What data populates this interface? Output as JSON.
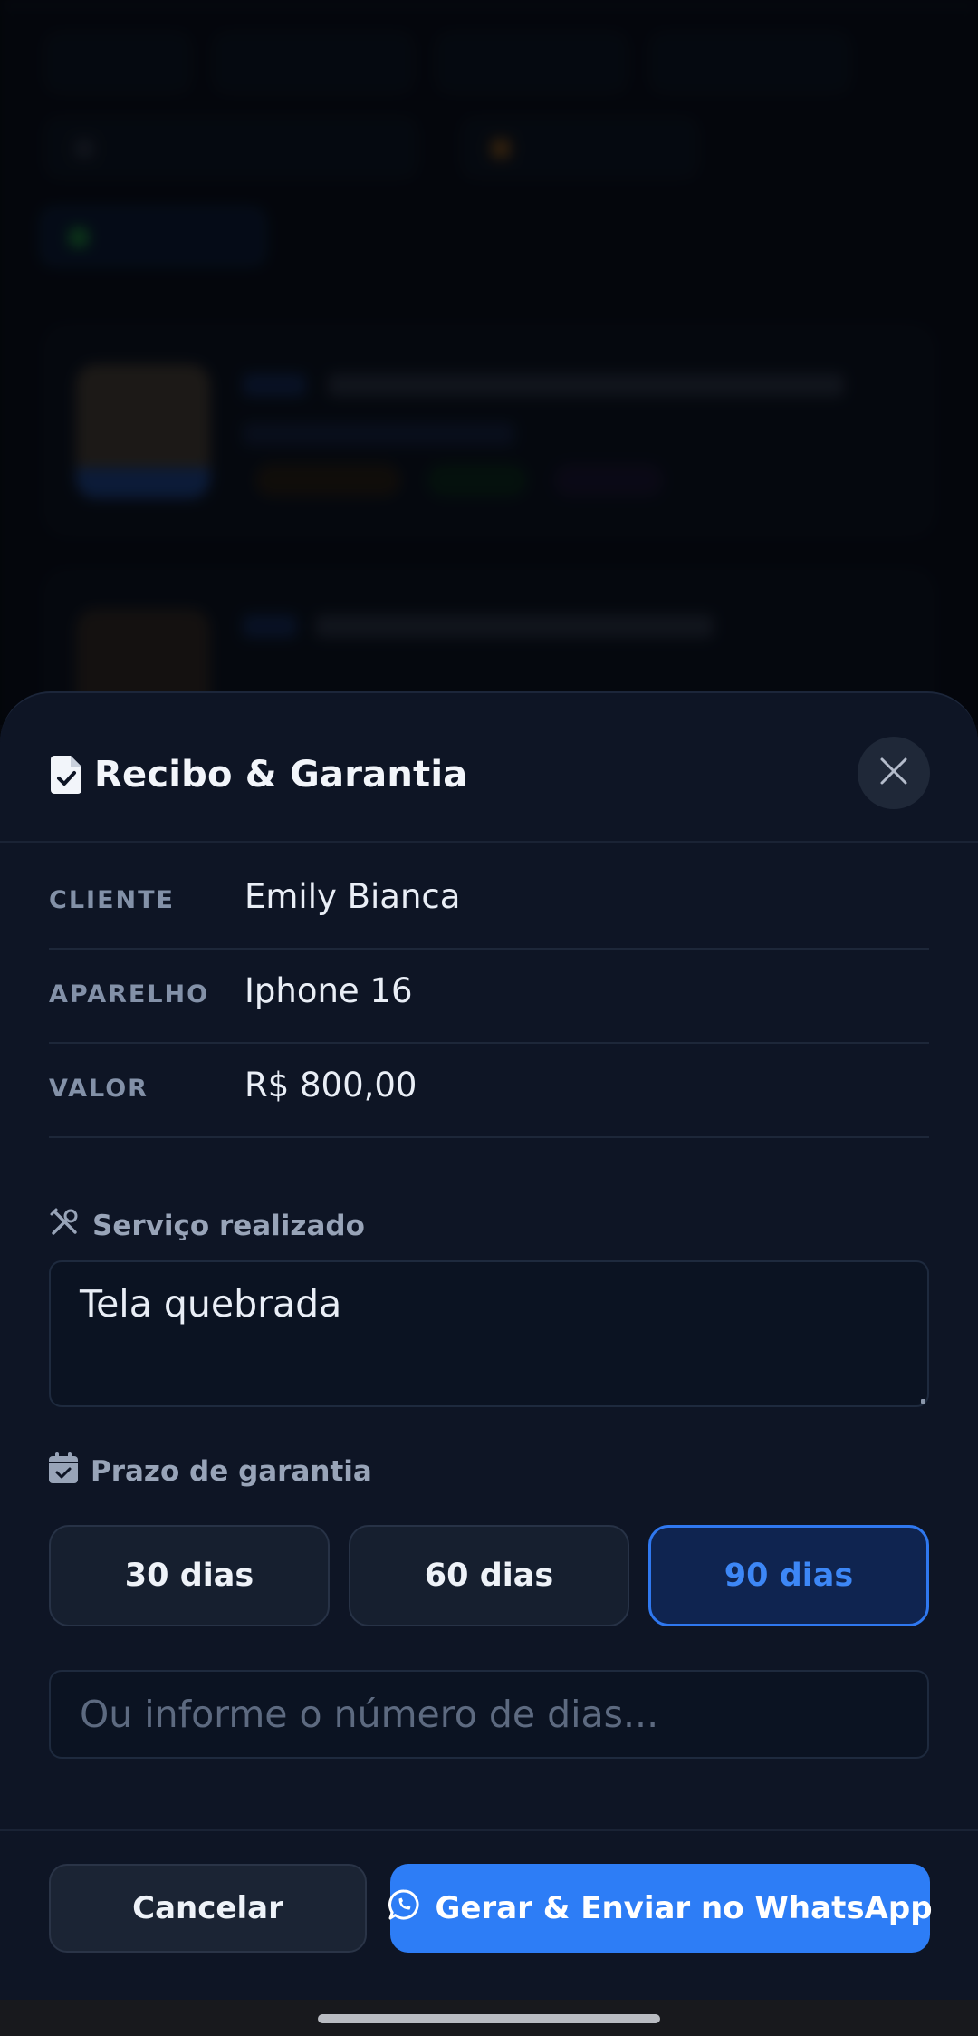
{
  "app": {
    "accent_color": "#2d7df6",
    "background_color": "#0e1525"
  },
  "sheet": {
    "title": "Recibo & Garantia",
    "title_icon": "receipt-check-icon",
    "close_icon": "close-icon"
  },
  "info": [
    {
      "label": "CLIENTE",
      "value": "Emily Bianca"
    },
    {
      "label": "APARELHO",
      "value": "Iphone 16"
    },
    {
      "label": "VALOR",
      "value": "R$ 800,00"
    }
  ],
  "service": {
    "label": "Serviço realizado",
    "icon": "tools-icon",
    "value": "Tela quebrada"
  },
  "warranty": {
    "label": "Prazo de garantia",
    "icon": "calendar-check-icon",
    "options": [
      "30 dias",
      "60 dias",
      "90 dias"
    ],
    "selected": "90 dias",
    "custom_placeholder": "Ou informe o número de dias..."
  },
  "footer": {
    "cancel_label": "Cancelar",
    "send_label": "Gerar & Enviar no WhatsApp",
    "send_icon": "whatsapp-icon"
  }
}
